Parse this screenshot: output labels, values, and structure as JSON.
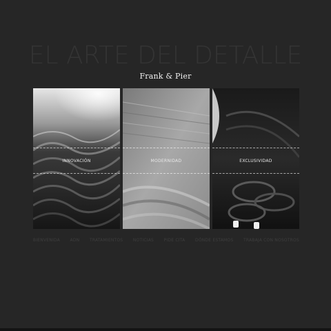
{
  "hero": {
    "title": "EL ARTE DEL DETALLE"
  },
  "brand": {
    "name": "Frank & Pier"
  },
  "panels": [
    {
      "label": "INNOVACIÓN"
    },
    {
      "label": "MODERNIDAD"
    },
    {
      "label": "EXCLUSIVIDAD"
    }
  ],
  "nav": {
    "items": [
      "BIENVENIDA",
      "ADN",
      "TRATAMIENTOS",
      "NOTICIAS",
      "PIDE CITA",
      "DÓNDE ESTAMOS",
      "TRABAJA CON NOSOTROS"
    ]
  },
  "colors": {
    "background": "#262626",
    "title": "#343434",
    "nav_text": "#3e3e3e",
    "brand_text": "#f2f2f2"
  }
}
